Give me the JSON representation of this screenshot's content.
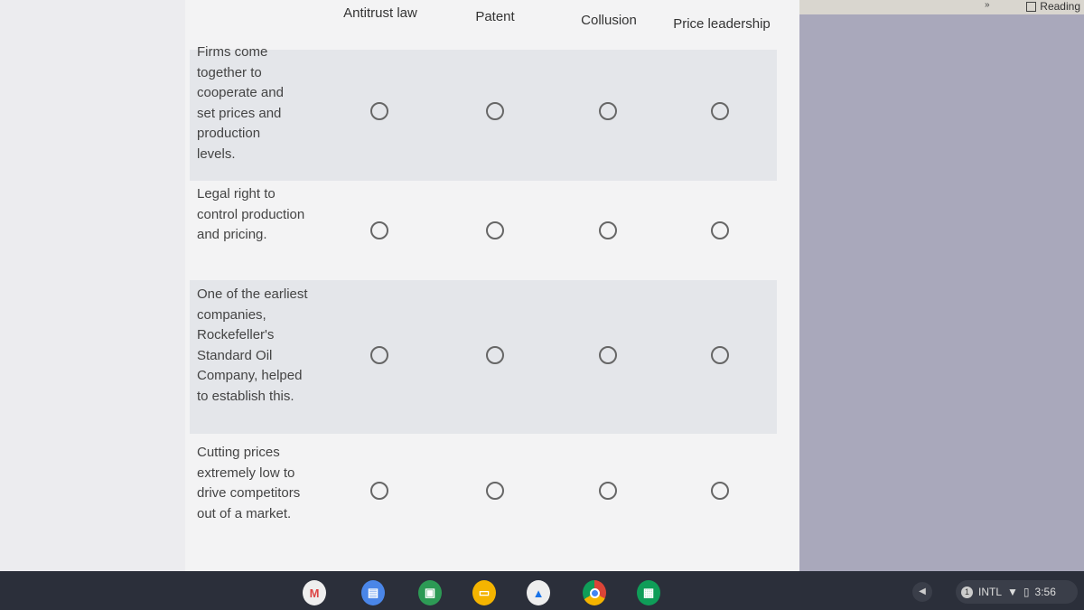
{
  "browser": {
    "reading_list_label": "Reading"
  },
  "grid": {
    "columns": [
      "Antitrust law",
      "Patent",
      "Collusion",
      "Price leadership"
    ],
    "rows": [
      {
        "label": "Firms come together to cooperate and set prices and production levels.",
        "selected": null
      },
      {
        "label": "Legal right to control production and pricing.",
        "selected": null
      },
      {
        "label": "One of the earliest companies, Rockefeller's Standard Oil Company, helped to establish this.",
        "selected": null
      },
      {
        "label": "Cutting prices extremely low to drive competitors out of a market.",
        "selected": null
      }
    ]
  },
  "shelf": {
    "apps": [
      "gmail-icon",
      "docs-icon",
      "classroom-icon",
      "slides-icon",
      "drive-icon",
      "chrome-icon",
      "sheets-icon"
    ],
    "notification_count": "1",
    "input_method": "INTL",
    "time": "3:56"
  }
}
